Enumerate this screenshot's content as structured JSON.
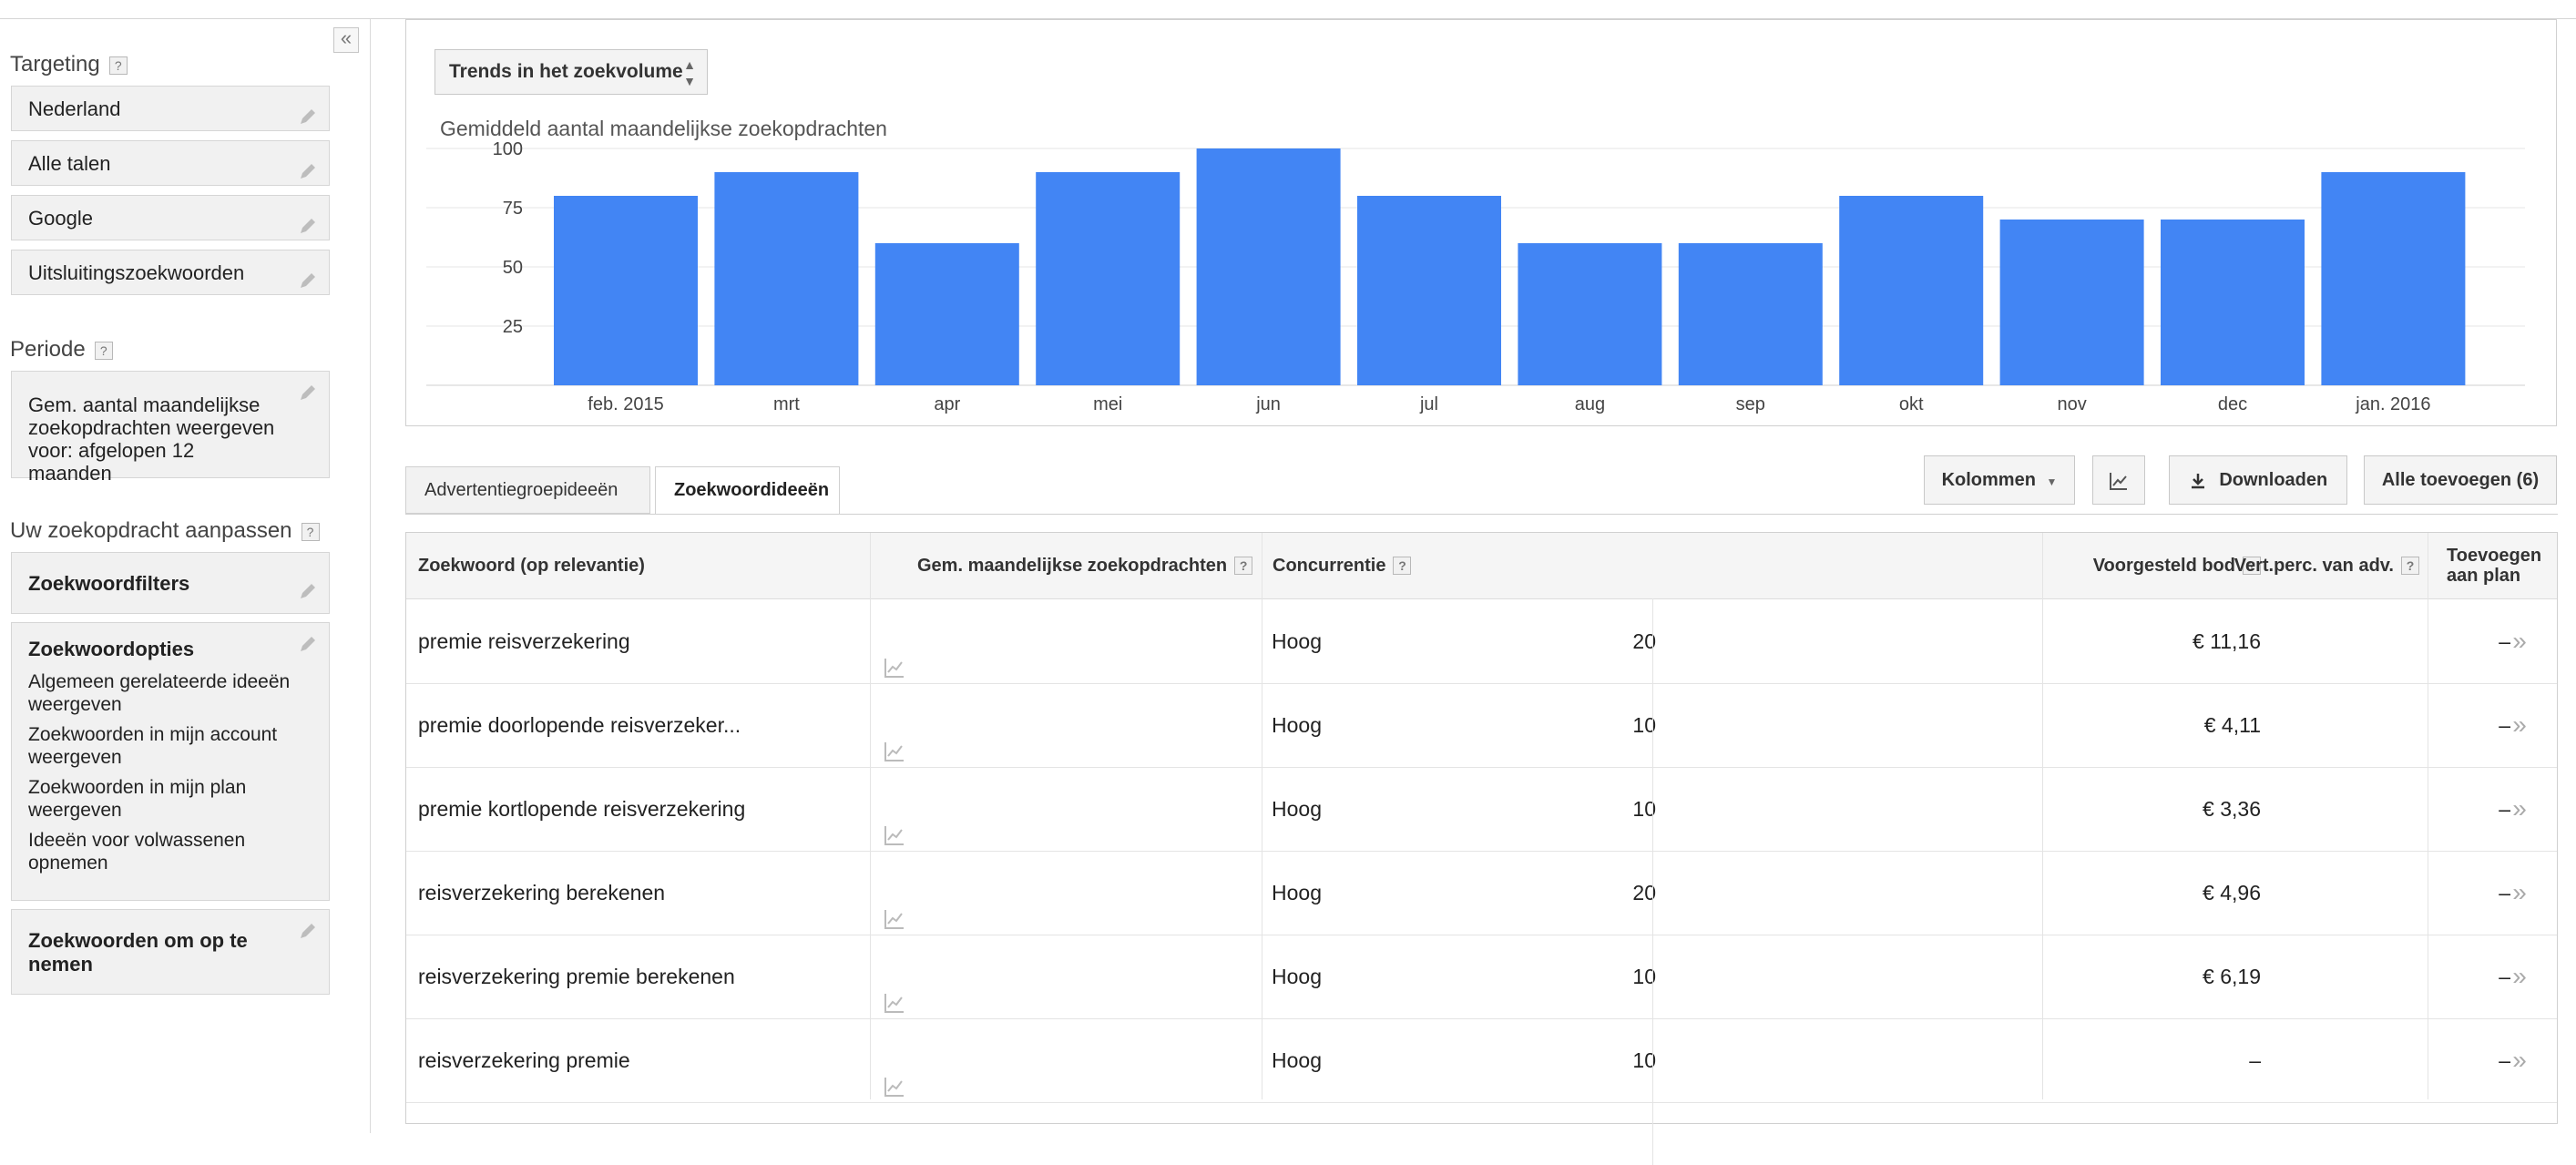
{
  "sidebar": {
    "targeting_title": "Targeting",
    "targeting_items": [
      "Nederland",
      "Alle talen",
      "Google",
      "Uitsluitingszoekwoorden"
    ],
    "periode_title": "Periode",
    "periode_text": "Gem. aantal maandelijkse zoekopdrachten weergeven voor: afgelopen 12 maanden",
    "aanpassen_title": "Uw zoekopdracht aanpassen",
    "filters_label": "Zoekwoordfilters",
    "opties_label": "Zoekwoordopties",
    "opties_items": [
      "Algemeen gerelateerde ideeën weergeven",
      "Zoekwoorden in mijn account weergeven",
      "Zoekwoorden in mijn plan weergeven",
      "Ideeën voor volwassenen opnemen"
    ],
    "opnemen_label": "Zoekwoorden om op te nemen",
    "help_symbol": "?",
    "collapse_symbol": "«"
  },
  "chart_panel": {
    "select_label": "Trends in het zoekvolume",
    "subtitle": "Gemiddeld aantal maandelijkse zoekopdrachten"
  },
  "chart_data": {
    "type": "bar",
    "categories": [
      "feb. 2015",
      "mrt",
      "apr",
      "mei",
      "jun",
      "jul",
      "aug",
      "sep",
      "okt",
      "nov",
      "dec",
      "jan. 2016"
    ],
    "values": [
      80,
      90,
      60,
      90,
      100,
      80,
      60,
      60,
      80,
      70,
      70,
      90
    ],
    "yticks": [
      25,
      50,
      75,
      100
    ],
    "ylim": [
      0,
      100
    ],
    "grid": true,
    "bar_color": "#4285f4"
  },
  "tabs": [
    "Advertentiegroepideeën",
    "Zoekwoordideeën"
  ],
  "toolbar": {
    "kolommen": "Kolommen",
    "downloaden": "Downloaden",
    "alle_toevoegen": "Alle toevoegen (6)"
  },
  "table": {
    "headers": {
      "keyword": "Zoekwoord (op relevantie)",
      "volume": "Gem. maandelijkse zoekopdrachten",
      "competition": "Concurrentie",
      "bid": "Voorgesteld bod",
      "impr": "Vert.perc. van adv.",
      "add_line1": "Toevoegen",
      "add_line2": "aan plan"
    },
    "rows": [
      {
        "keyword": "premie reisverzekering",
        "volume": "20",
        "competition": "Hoog",
        "bid": "€ 11,16",
        "impr": "–",
        "add": "»"
      },
      {
        "keyword": "premie doorlopende reisverzeker...",
        "volume": "10",
        "competition": "Hoog",
        "bid": "€ 4,11",
        "impr": "–",
        "add": "»"
      },
      {
        "keyword": "premie kortlopende reisverzekering",
        "volume": "10",
        "competition": "Hoog",
        "bid": "€ 3,36",
        "impr": "–",
        "add": "»"
      },
      {
        "keyword": "reisverzekering berekenen",
        "volume": "20",
        "competition": "Hoog",
        "bid": "€ 4,96",
        "impr": "–",
        "add": "»"
      },
      {
        "keyword": "reisverzekering premie berekenen",
        "volume": "10",
        "competition": "Hoog",
        "bid": "€ 6,19",
        "impr": "–",
        "add": "»"
      },
      {
        "keyword": "reisverzekering premie",
        "volume": "10",
        "competition": "Hoog",
        "bid": "–",
        "impr": "–",
        "add": "»"
      }
    ]
  }
}
